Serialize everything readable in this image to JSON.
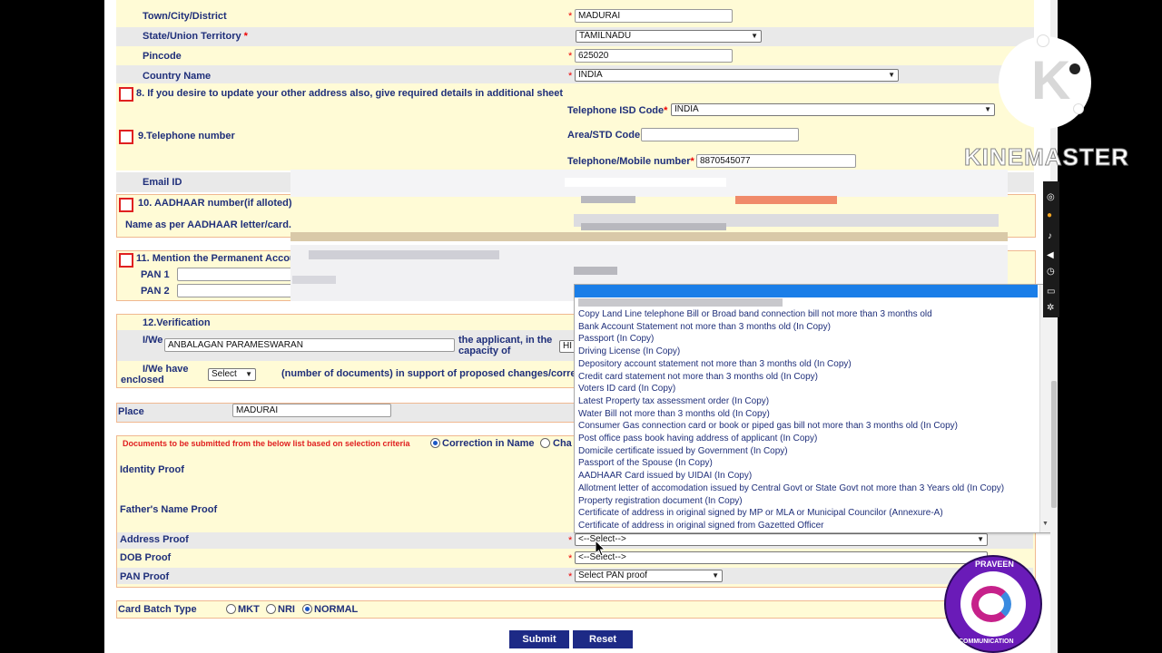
{
  "address": {
    "town_label": "Town/City/District",
    "town_value": "MADURAI",
    "state_label": "State/Union Territory",
    "state_value": "TAMILNADU",
    "pincode_label": "Pincode",
    "pincode_value": "625020",
    "country_label": "Country Name",
    "country_value": "INDIA",
    "other_address_label": "8. If you desire to update your other address also, give required details in additional sheet"
  },
  "telephone": {
    "section_label": "9.Telephone number",
    "isd_label": "Telephone ISD Code",
    "isd_value": "INDIA",
    "std_label": "Area/STD Code",
    "std_value": "",
    "mobile_label": "Telephone/Mobile number",
    "mobile_value": "8870545077"
  },
  "email": {
    "label": "Email ID"
  },
  "aadhaar": {
    "label": "10. AADHAAR number(if alloted)",
    "name_label": "Name as per AADHAAR letter/card."
  },
  "pan": {
    "label": "11. Mention the Permanent Accou",
    "pan1_label": "PAN 1",
    "pan2_label": "PAN 2"
  },
  "verification": {
    "title": "12.Verification",
    "iwe_label": "I/We",
    "iwe_value": "ANBALAGAN PARAMESWARAN",
    "capacity_label_1": "the applicant, in the",
    "capacity_label_2": "capacity of",
    "capacity_value": "HI",
    "enclosed_label_1": "I/We have",
    "enclosed_label_2": "enclosed",
    "enclosed_select": "Select",
    "enclosed_suffix": "(number of documents) in support of proposed changes/corre"
  },
  "place": {
    "label": "Place",
    "value": "MADURAI"
  },
  "documents": {
    "note": "Documents to be submitted from the below list based on selection criteria",
    "radio_correction": "Correction in Name",
    "radio_change": "Cha",
    "identity_label": "Identity Proof",
    "father_label": "Father's Name Proof",
    "address_label": "Address Proof",
    "address_value": "<--Select-->",
    "dob_label": "DOB Proof",
    "dob_value": "<--Select-->",
    "pan_label": "PAN Proof",
    "pan_value": "Select PAN proof"
  },
  "dropdown_options": [
    "Copy Land Line telephone Bill or Broad band connection bill not more than 3 months old",
    "Bank Account Statement not more than 3 months old (In Copy)",
    "Passport (In Copy)",
    "Driving License (In Copy)",
    "Depository account statement not more than 3 months old (In Copy)",
    "Credit card statement not more than 3 months old (In Copy)",
    "Voters ID card (In Copy)",
    "Latest Property tax assessment order (In Copy)",
    "Water Bill not more than 3 months old (In Copy)",
    "Consumer Gas connection card or book or piped gas bill not more than 3 months old (In Copy)",
    "Post office pass book having address of applicant (In Copy)",
    "Domicile certificate issued by Government (In Copy)",
    "Passport of the Spouse (In Copy)",
    "AADHAAR Card issued by UIDAI (In Copy)",
    "Allotment letter of accomodation issued by Central Govt or State Govt not more than 3 Years old (In Copy)",
    "Property registration document (In Copy)",
    "Certificate of address in original signed by MP or MLA or Municipal Councilor (Annexure-A)",
    "Certificate of address in original signed from Gazetted Officer"
  ],
  "card_batch": {
    "label": "Card Batch Type",
    "opt_mkt": "MKT",
    "opt_nri": "NRI",
    "opt_normal": "NORMAL"
  },
  "buttons": {
    "submit": "Submit",
    "reset": "Reset"
  },
  "watermark": {
    "kinemaster": "KINEMASTER",
    "logo_letter": "K",
    "badge_top": "PRAVEEN",
    "badge_bottom": "COMMUNICATION"
  },
  "colors": {
    "form_yellow": "#fffbd6",
    "form_gray": "#e9e9e9",
    "label_blue": "#1f2f7a",
    "button_navy": "#1d2a86",
    "highlight_blue": "#1a7ee8",
    "required_red": "#e00000"
  }
}
